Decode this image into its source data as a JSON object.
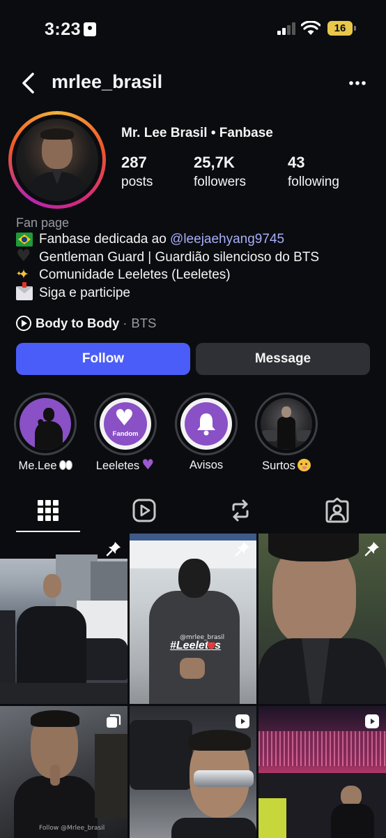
{
  "status_bar": {
    "time": "3:23",
    "battery": "16"
  },
  "header": {
    "username": "mrlee_brasil"
  },
  "profile": {
    "display_name": "Mr. Lee Brasil • Fanbase",
    "stats": [
      {
        "value": "287",
        "label": "posts"
      },
      {
        "value": "25,7K",
        "label": "followers"
      },
      {
        "value": "43",
        "label": "following"
      }
    ],
    "category": "Fan page",
    "bio": {
      "line1_text": "Fanbase dedicada ao ",
      "line1_mention": "@leejaehyang9745",
      "line2": "Gentleman Guard | Guardião silencioso do BTS",
      "line3": "Comunidade Leeletes (Leeletes)",
      "line4": "Siga e participe"
    },
    "audio": {
      "song": "Body to Body",
      "separator": "·",
      "artist": "BTS"
    }
  },
  "actions": {
    "follow": "Follow",
    "message": "Message"
  },
  "highlights": [
    {
      "label": "Me.Lee"
    },
    {
      "label": "Leeletes",
      "badge_text": "Fandom"
    },
    {
      "label": "Avisos"
    },
    {
      "label": "Surtos"
    }
  ],
  "tabs": [
    {
      "icon": "grid-icon"
    },
    {
      "icon": "reels-icon"
    },
    {
      "icon": "reposts-icon"
    },
    {
      "icon": "tagged-icon"
    }
  ],
  "posts": [
    {
      "badge": "pin-icon"
    },
    {
      "badge": "pin-icon",
      "watermark": "@mrlee_brasil",
      "caption": "#Leeletes"
    },
    {
      "badge": "pin-icon"
    },
    {
      "badge": "carousel-icon",
      "watermark": "Follow @Mrlee_brasil"
    },
    {
      "badge": "reel-icon"
    },
    {
      "badge": "reel-icon"
    }
  ],
  "colors": {
    "background": "#0b0c10",
    "follow_button": "#4a5df9",
    "message_button": "#2f3035",
    "mention": "#a8aef8",
    "highlight_purple": "#8a50c6"
  }
}
